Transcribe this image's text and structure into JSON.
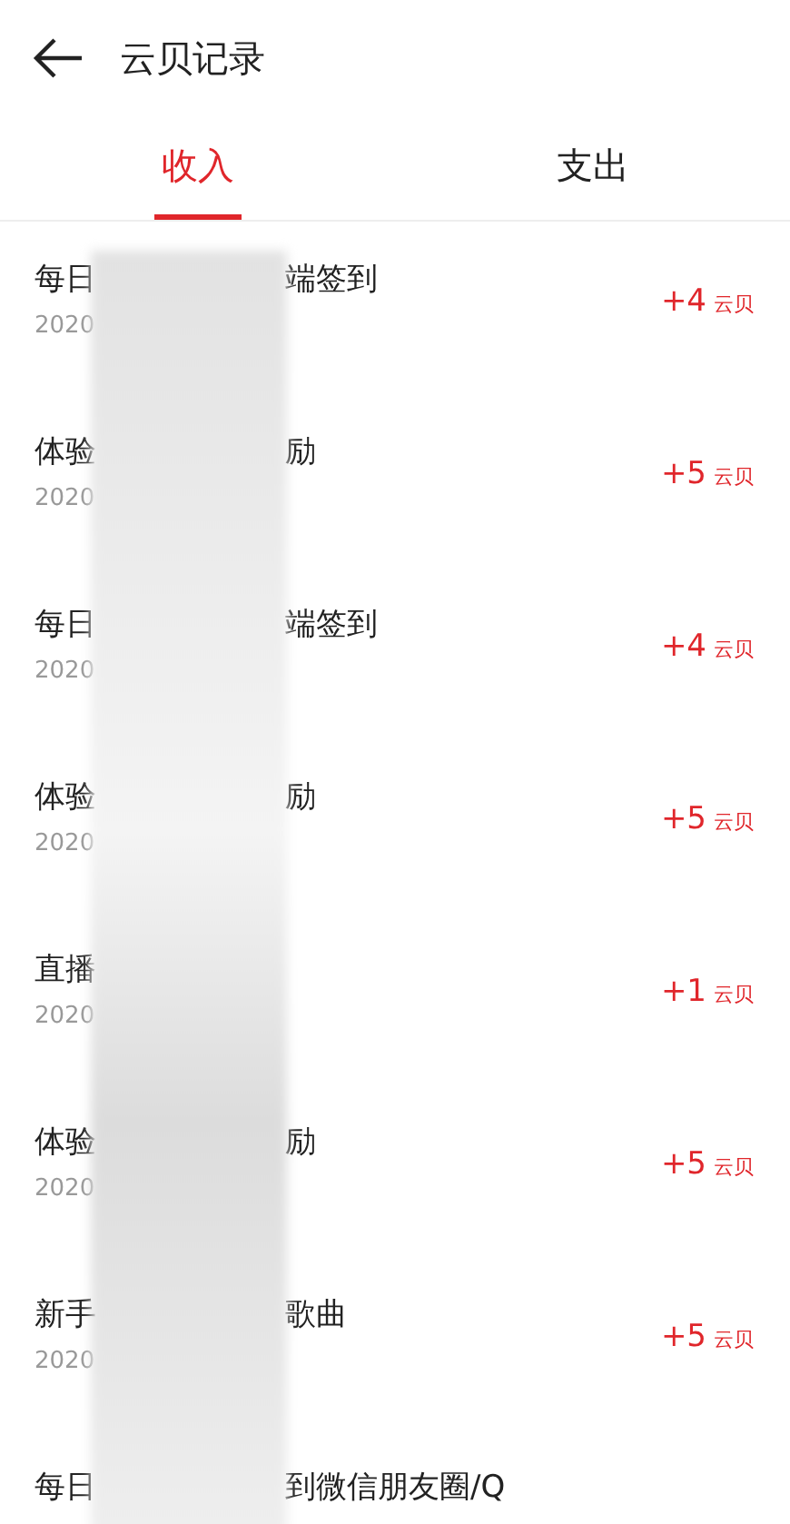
{
  "header": {
    "title": "云贝记录"
  },
  "tabs": [
    {
      "label": "收入",
      "selected": true
    },
    {
      "label": "支出",
      "selected": false
    }
  ],
  "records": [
    {
      "title_start": "每日",
      "title_end": "端签到",
      "date": "2020",
      "amount": "+4",
      "unit": "云贝"
    },
    {
      "title_start": "体验",
      "title_end": "励",
      "date": "2020",
      "amount": "+5",
      "unit": "云贝"
    },
    {
      "title_start": "每日",
      "title_end": "端签到",
      "date": "2020",
      "amount": "+4",
      "unit": "云贝"
    },
    {
      "title_start": "体验",
      "title_end": "励",
      "date": "2020",
      "amount": "+5",
      "unit": "云贝"
    },
    {
      "title_start": "直播",
      "date": "2020",
      "amount": "+1",
      "unit": "云贝"
    },
    {
      "title_start": "体验",
      "title_end": "励",
      "date": "2020",
      "amount": "+5",
      "unit": "云贝"
    },
    {
      "title_start": "新手",
      "title_end": "歌曲",
      "date": "2020",
      "amount": "+5",
      "unit": "云贝"
    },
    {
      "title_start": "每日",
      "title_end": "到微信朋友圈/Q"
    }
  ]
}
